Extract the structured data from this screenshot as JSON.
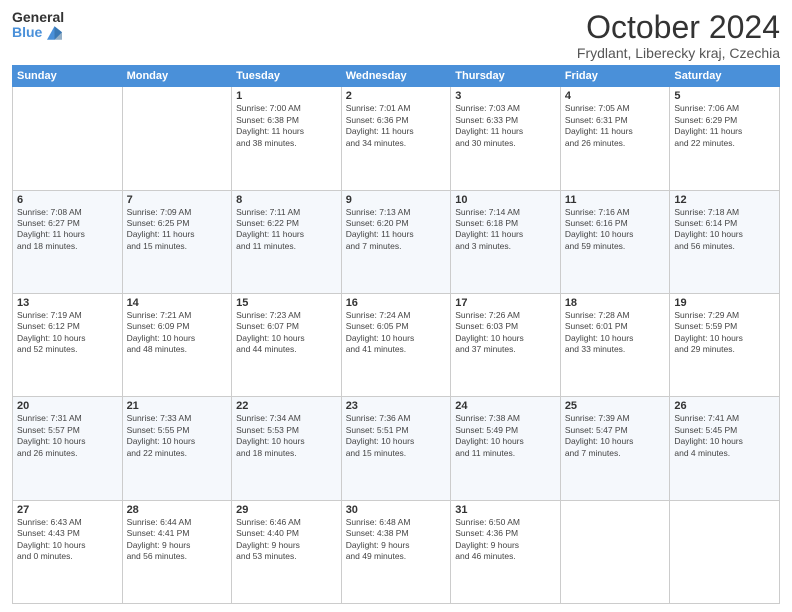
{
  "header": {
    "logo_general": "General",
    "logo_blue": "Blue",
    "month_title": "October 2024",
    "location": "Frydlant, Liberecky kraj, Czechia"
  },
  "weekdays": [
    "Sunday",
    "Monday",
    "Tuesday",
    "Wednesday",
    "Thursday",
    "Friday",
    "Saturday"
  ],
  "weeks": [
    [
      {
        "day": "",
        "info": ""
      },
      {
        "day": "",
        "info": ""
      },
      {
        "day": "1",
        "info": "Sunrise: 7:00 AM\nSunset: 6:38 PM\nDaylight: 11 hours\nand 38 minutes."
      },
      {
        "day": "2",
        "info": "Sunrise: 7:01 AM\nSunset: 6:36 PM\nDaylight: 11 hours\nand 34 minutes."
      },
      {
        "day": "3",
        "info": "Sunrise: 7:03 AM\nSunset: 6:33 PM\nDaylight: 11 hours\nand 30 minutes."
      },
      {
        "day": "4",
        "info": "Sunrise: 7:05 AM\nSunset: 6:31 PM\nDaylight: 11 hours\nand 26 minutes."
      },
      {
        "day": "5",
        "info": "Sunrise: 7:06 AM\nSunset: 6:29 PM\nDaylight: 11 hours\nand 22 minutes."
      }
    ],
    [
      {
        "day": "6",
        "info": "Sunrise: 7:08 AM\nSunset: 6:27 PM\nDaylight: 11 hours\nand 18 minutes."
      },
      {
        "day": "7",
        "info": "Sunrise: 7:09 AM\nSunset: 6:25 PM\nDaylight: 11 hours\nand 15 minutes."
      },
      {
        "day": "8",
        "info": "Sunrise: 7:11 AM\nSunset: 6:22 PM\nDaylight: 11 hours\nand 11 minutes."
      },
      {
        "day": "9",
        "info": "Sunrise: 7:13 AM\nSunset: 6:20 PM\nDaylight: 11 hours\nand 7 minutes."
      },
      {
        "day": "10",
        "info": "Sunrise: 7:14 AM\nSunset: 6:18 PM\nDaylight: 11 hours\nand 3 minutes."
      },
      {
        "day": "11",
        "info": "Sunrise: 7:16 AM\nSunset: 6:16 PM\nDaylight: 10 hours\nand 59 minutes."
      },
      {
        "day": "12",
        "info": "Sunrise: 7:18 AM\nSunset: 6:14 PM\nDaylight: 10 hours\nand 56 minutes."
      }
    ],
    [
      {
        "day": "13",
        "info": "Sunrise: 7:19 AM\nSunset: 6:12 PM\nDaylight: 10 hours\nand 52 minutes."
      },
      {
        "day": "14",
        "info": "Sunrise: 7:21 AM\nSunset: 6:09 PM\nDaylight: 10 hours\nand 48 minutes."
      },
      {
        "day": "15",
        "info": "Sunrise: 7:23 AM\nSunset: 6:07 PM\nDaylight: 10 hours\nand 44 minutes."
      },
      {
        "day": "16",
        "info": "Sunrise: 7:24 AM\nSunset: 6:05 PM\nDaylight: 10 hours\nand 41 minutes."
      },
      {
        "day": "17",
        "info": "Sunrise: 7:26 AM\nSunset: 6:03 PM\nDaylight: 10 hours\nand 37 minutes."
      },
      {
        "day": "18",
        "info": "Sunrise: 7:28 AM\nSunset: 6:01 PM\nDaylight: 10 hours\nand 33 minutes."
      },
      {
        "day": "19",
        "info": "Sunrise: 7:29 AM\nSunset: 5:59 PM\nDaylight: 10 hours\nand 29 minutes."
      }
    ],
    [
      {
        "day": "20",
        "info": "Sunrise: 7:31 AM\nSunset: 5:57 PM\nDaylight: 10 hours\nand 26 minutes."
      },
      {
        "day": "21",
        "info": "Sunrise: 7:33 AM\nSunset: 5:55 PM\nDaylight: 10 hours\nand 22 minutes."
      },
      {
        "day": "22",
        "info": "Sunrise: 7:34 AM\nSunset: 5:53 PM\nDaylight: 10 hours\nand 18 minutes."
      },
      {
        "day": "23",
        "info": "Sunrise: 7:36 AM\nSunset: 5:51 PM\nDaylight: 10 hours\nand 15 minutes."
      },
      {
        "day": "24",
        "info": "Sunrise: 7:38 AM\nSunset: 5:49 PM\nDaylight: 10 hours\nand 11 minutes."
      },
      {
        "day": "25",
        "info": "Sunrise: 7:39 AM\nSunset: 5:47 PM\nDaylight: 10 hours\nand 7 minutes."
      },
      {
        "day": "26",
        "info": "Sunrise: 7:41 AM\nSunset: 5:45 PM\nDaylight: 10 hours\nand 4 minutes."
      }
    ],
    [
      {
        "day": "27",
        "info": "Sunrise: 6:43 AM\nSunset: 4:43 PM\nDaylight: 10 hours\nand 0 minutes."
      },
      {
        "day": "28",
        "info": "Sunrise: 6:44 AM\nSunset: 4:41 PM\nDaylight: 9 hours\nand 56 minutes."
      },
      {
        "day": "29",
        "info": "Sunrise: 6:46 AM\nSunset: 4:40 PM\nDaylight: 9 hours\nand 53 minutes."
      },
      {
        "day": "30",
        "info": "Sunrise: 6:48 AM\nSunset: 4:38 PM\nDaylight: 9 hours\nand 49 minutes."
      },
      {
        "day": "31",
        "info": "Sunrise: 6:50 AM\nSunset: 4:36 PM\nDaylight: 9 hours\nand 46 minutes."
      },
      {
        "day": "",
        "info": ""
      },
      {
        "day": "",
        "info": ""
      }
    ]
  ]
}
